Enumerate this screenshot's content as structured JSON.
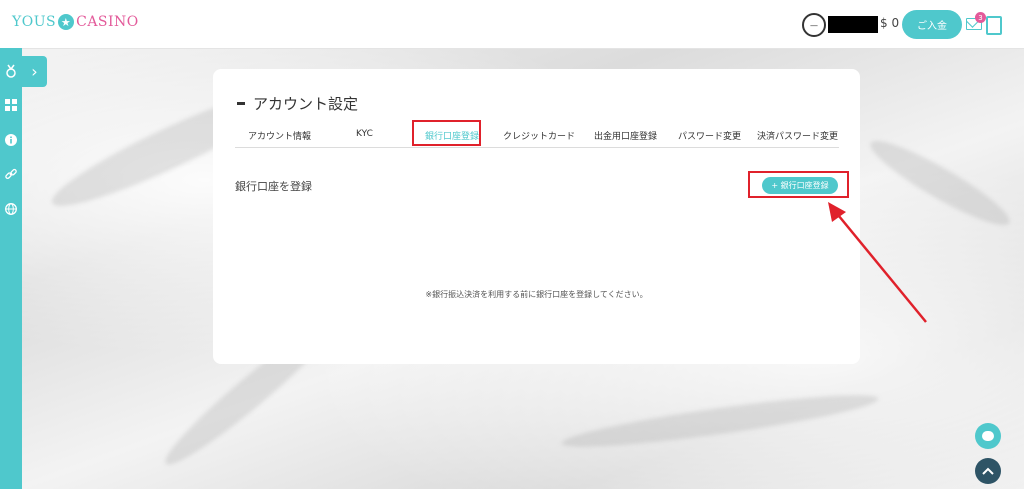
{
  "header": {
    "logo_left": "YOUS",
    "logo_star": "★",
    "logo_right": "CASINO",
    "balance": "$ 0",
    "deposit_label": "ご入金",
    "mail_badge": "3"
  },
  "sidebar": {
    "expand_icon": "›"
  },
  "account": {
    "title": "アカウント設定",
    "tabs": [
      {
        "label": "アカウント情報"
      },
      {
        "label": "KYC"
      },
      {
        "label": "銀行口座登録"
      },
      {
        "label": "クレジットカード"
      },
      {
        "label": "出金用口座登録"
      },
      {
        "label": "パスワード変更"
      },
      {
        "label": "決済パスワード変更"
      }
    ],
    "active_tab": 2,
    "section_label": "銀行口座を登録",
    "add_button_label": "+ 銀行口座登録",
    "notice": "※銀行振込決済を利用する前に銀行口座を登録してください。"
  },
  "colors": {
    "accent": "#4fc8cc",
    "highlight": "#e0212b",
    "logo_pink": "#e35a9a"
  }
}
